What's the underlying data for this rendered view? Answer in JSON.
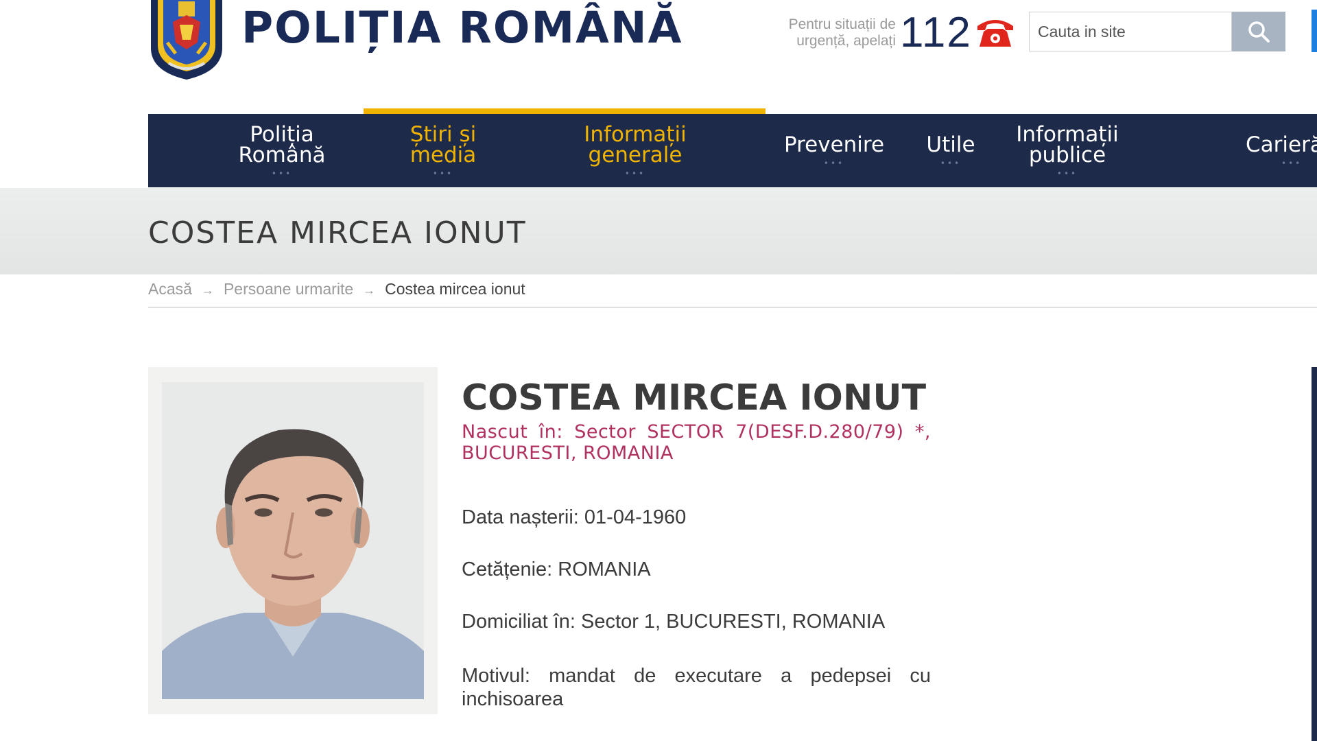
{
  "header": {
    "site_title": "POLIȚIA ROMÂNĂ",
    "emergency_note_line1": "Pentru situații de",
    "emergency_note_line2": "urgență, apelați",
    "emergency_number": "112",
    "search_placeholder": "Cauta in site",
    "colors": {
      "brand_navy": "#1a2a57",
      "accent_yellow": "#f0b400",
      "alert_red": "#e0261c"
    }
  },
  "nav": {
    "items": [
      {
        "label": "Poliția\nRomână",
        "active": false
      },
      {
        "label": "Știri și\nmedia",
        "active": true
      },
      {
        "label": "Informații\ngenerale",
        "active": true
      },
      {
        "label": "Prevenire",
        "active": false
      },
      {
        "label": "Utile",
        "active": false
      },
      {
        "label": "Informații\npublice",
        "active": false
      },
      {
        "label": "Carieră",
        "active": false
      }
    ],
    "dots": "•••"
  },
  "page": {
    "title": "COSTEA MIRCEA IONUT"
  },
  "breadcrumb": {
    "home": "Acasă",
    "section": "Persoane urmarite",
    "current": "Costea mircea ionut",
    "separator": "→"
  },
  "profile": {
    "name": "COSTEA MIRCEA IONUT",
    "birthplace": "Nascut în: Sector SECTOR 7(DESF.D.280/79) *, BUCURESTI, ROMANIA",
    "birth_date": "Data nașterii: 01-04-1960",
    "citizenship": "Cetățenie: ROMANIA",
    "domicile": "Domiciliat în: Sector 1, BUCURESTI, ROMANIA",
    "motive": "Motivul: mandat de executare a pedepsei cu inchisoarea"
  }
}
